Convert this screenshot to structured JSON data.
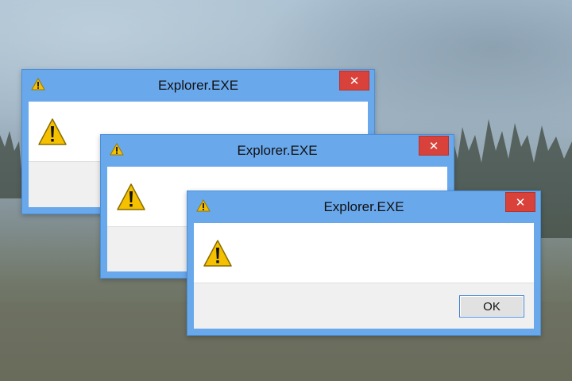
{
  "dialogs": [
    {
      "title": "Explorer.EXE",
      "close_glyph": "✕"
    },
    {
      "title": "Explorer.EXE",
      "close_glyph": "✕"
    },
    {
      "title": "Explorer.EXE",
      "close_glyph": "✕",
      "ok_label": "OK"
    }
  ],
  "icons": {
    "title": "warning-icon",
    "body": "warning-icon",
    "close": "close-icon"
  },
  "colors": {
    "titlebar": "#6aa8ec",
    "close": "#d9423a",
    "warning": "#f5c000",
    "ok_border": "#3c7fd1"
  }
}
